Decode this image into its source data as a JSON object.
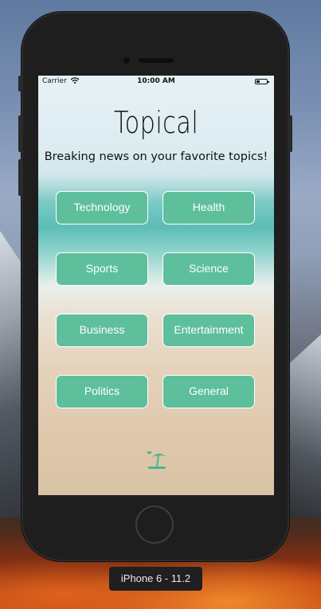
{
  "status_bar": {
    "carrier": "Carrier",
    "time": "10:00 AM"
  },
  "app": {
    "title": "Topical",
    "subtitle": "Breaking news on your favorite topics!",
    "topics": [
      "Technology",
      "Health",
      "Sports",
      "Science",
      "Business",
      "Entertainment",
      "Politics",
      "General"
    ],
    "footer_icon": "beach-umbrella-icon"
  },
  "simulator": {
    "device_label": "iPhone 6 - 11.2"
  },
  "colors": {
    "button_fill": "#5ebf9c",
    "button_border": "#ffffff",
    "icon_teal": "#4fb38f"
  }
}
